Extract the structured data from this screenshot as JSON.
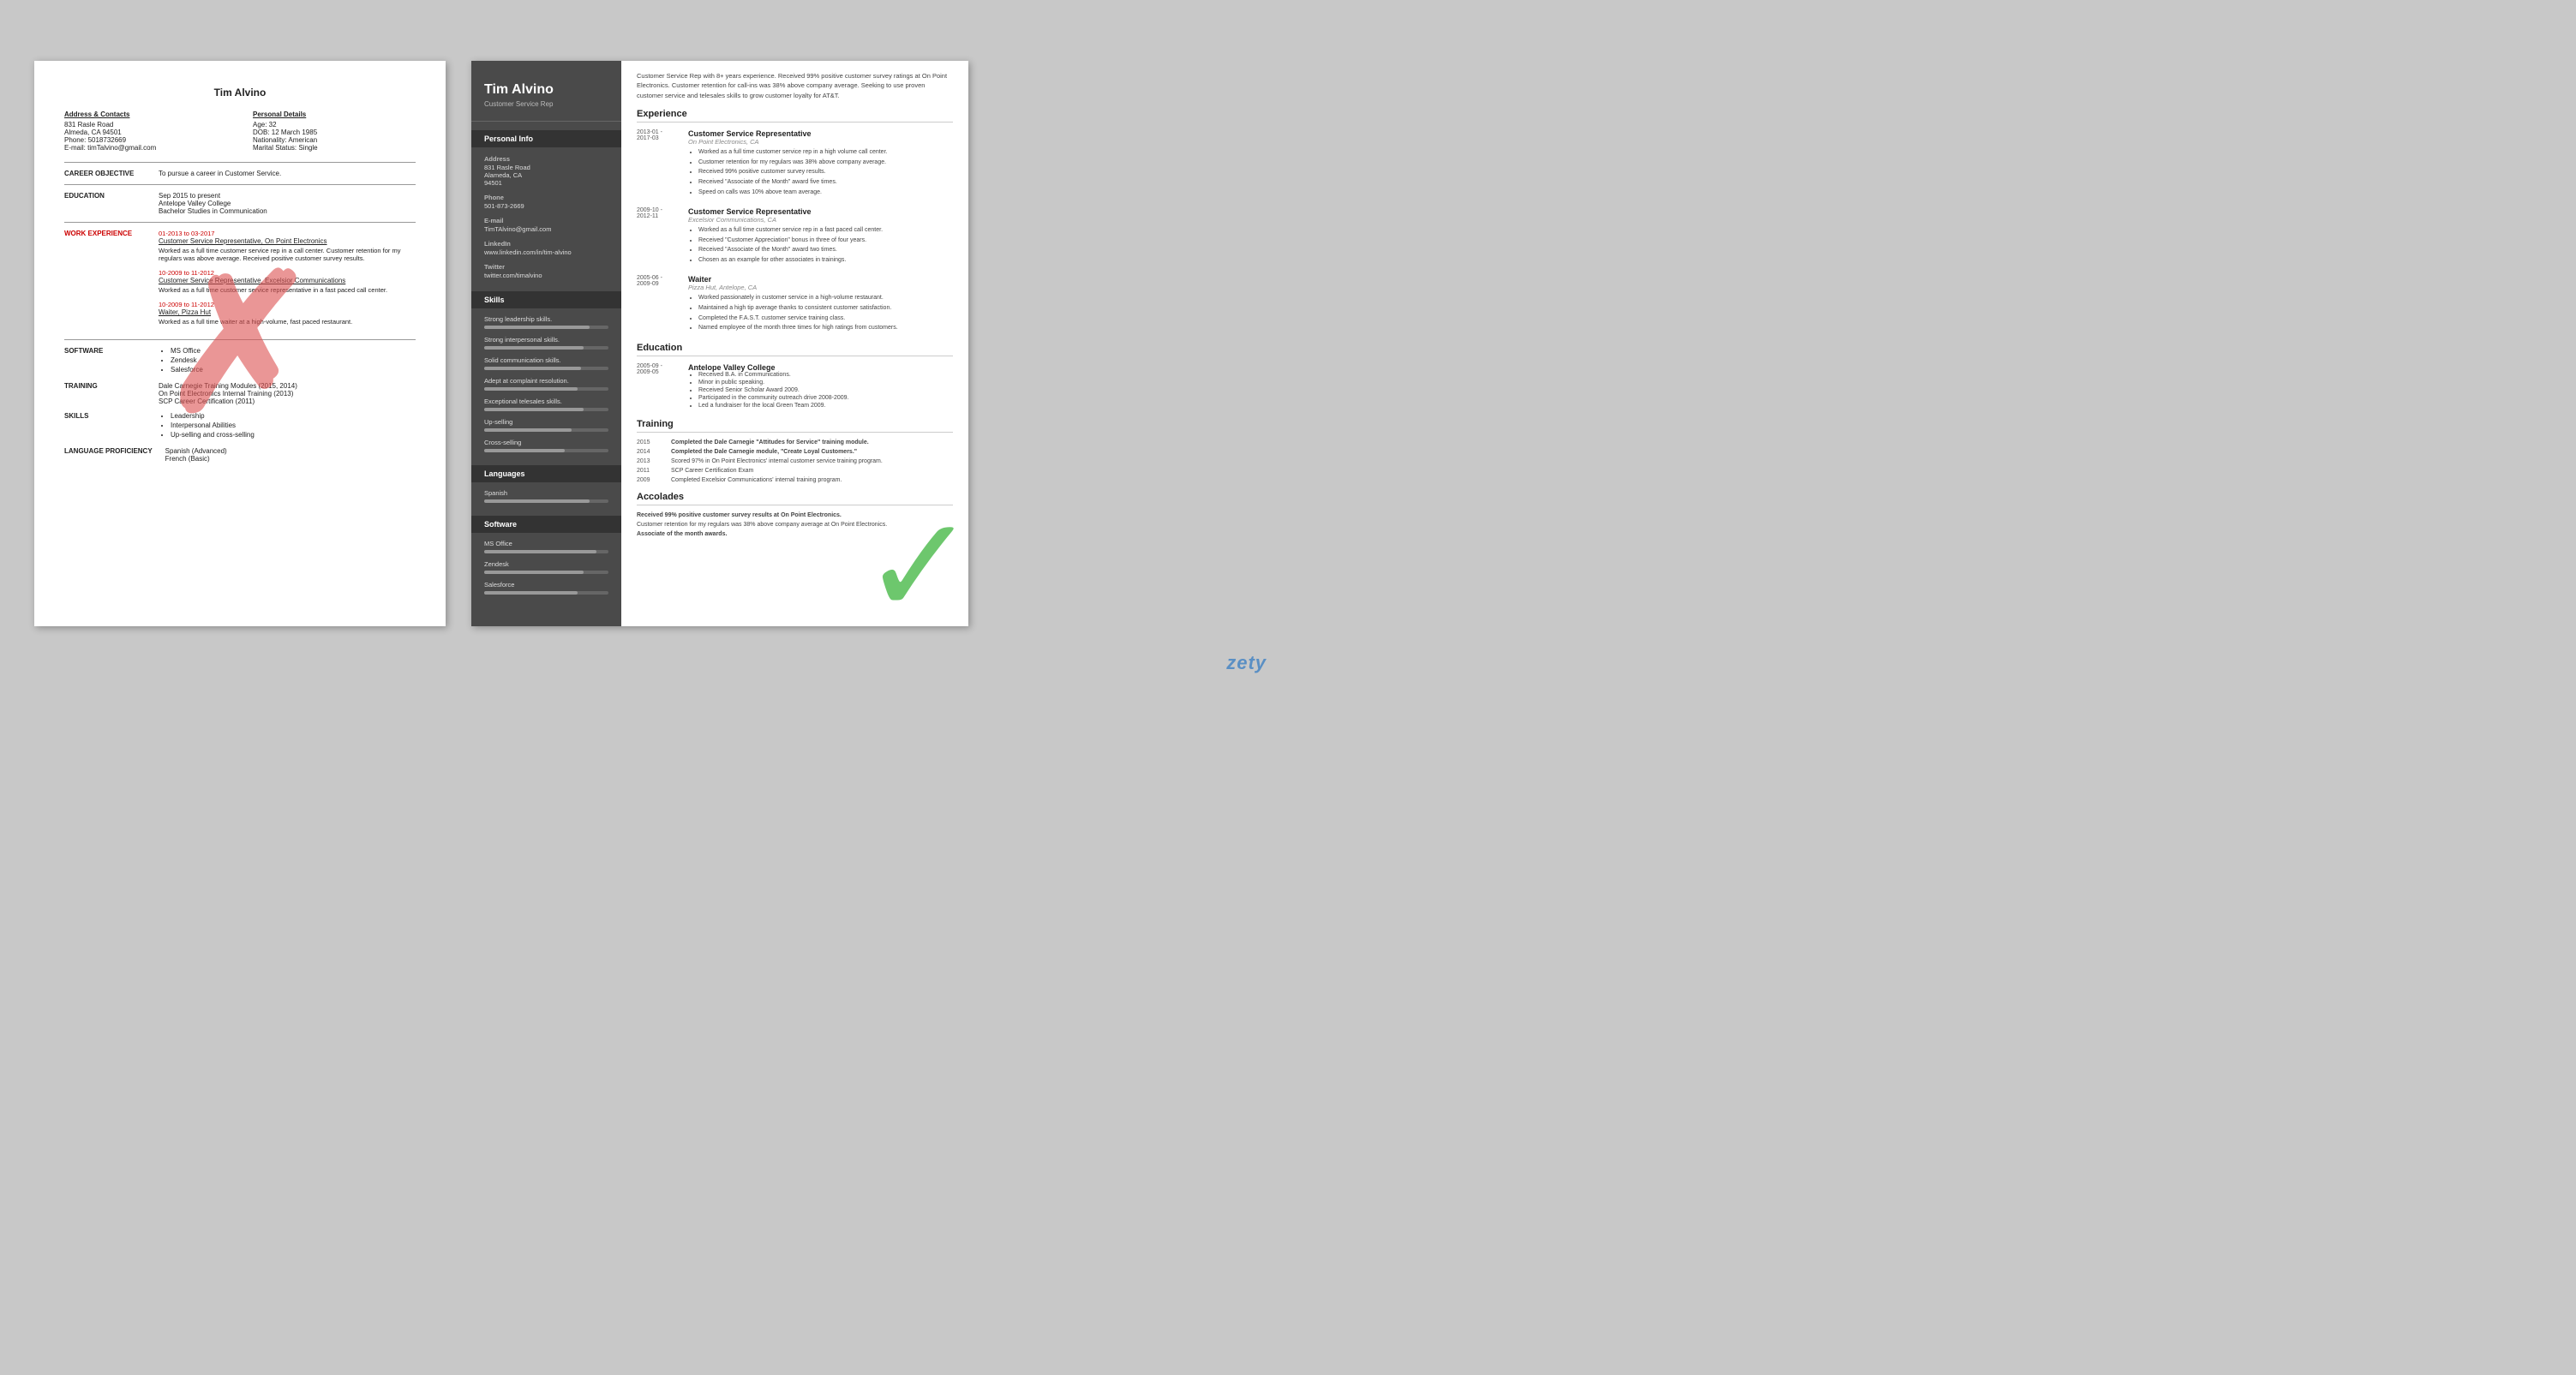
{
  "bad_resume": {
    "name": "Tim Alvino",
    "address_title": "Address & Contacts",
    "address_lines": [
      "831 Rasle Road",
      "Almeda, CA 94501",
      "Phone: 5018732669",
      "E-mail: timTalvino@gmail.com"
    ],
    "personal_title": "Personal Details",
    "personal_lines": [
      "Age:   32",
      "DOB:  12 March 1985",
      "Nationality: American",
      "Marital Status: Single"
    ],
    "career_objective_label": "CAREER OBJECTIVE",
    "career_objective": "To pursue a career in Customer Service.",
    "education_label": "EDUCATION",
    "education_period": "Sep 2015 to present",
    "education_school": "Antelope Valley College",
    "education_degree": "Bachelor Studies in Communication",
    "work_experience_label": "WORK EXPERIENCE",
    "work_entries": [
      {
        "date": "01-2013 to 03-2017",
        "title": "Customer Service Representative, On Point Electronics",
        "desc": "Worked as a full time customer service rep in a call center. Customer retention for my regulars was above average. Received positive customer survey results."
      },
      {
        "date": "10-2009 to 11-2012",
        "title": "Customer Service Representative, Excelsior Communications",
        "desc": "Worked as a full time customer service representative in a fast paced call center."
      },
      {
        "date": "10-2009 to 11-2012",
        "title": "Waiter, Pizza Hut",
        "desc": "Worked as a full time waiter at a high-volume, fast paced restaurant."
      }
    ],
    "software_label": "SOFTWARE",
    "software_items": [
      "MS Office",
      "Zendesk",
      "Salesforce"
    ],
    "training_label": "TRAINING",
    "training_items": [
      "Dale Carnegie Training Modules (2015, 2014)",
      "On Point Electronics Internal Training (2013)",
      "SCP Career Certification (2011)"
    ],
    "skills_label": "SKILLS",
    "skills_items": [
      "Leadership",
      "Interpersonal Abilities",
      "Up-selling and cross-selling"
    ],
    "language_label": "LANGUAGE PROFICIENCY",
    "language_items": [
      "Spanish (Advanced)",
      "French (Basic)"
    ]
  },
  "good_resume": {
    "name": "Tim Alvino",
    "title": "Customer Service Rep",
    "summary": "Customer Service Rep with 8+ years experience. Received 99% positive customer survey ratings at On Point Electronics. Customer retention for call-ins was 38% above company average. Seeking to use proven customer service and telesales skills to grow customer loyalty for AT&T.",
    "personal_info_header": "Personal Info",
    "address_label": "Address",
    "address_value": "831 Rasle Road\nAlameda, CA\n94501",
    "phone_label": "Phone",
    "phone_value": "501-873-2669",
    "email_label": "E-mail",
    "email_value": "TimTAlvino@gmail.com",
    "linkedin_label": "LinkedIn",
    "linkedin_value": "www.linkedin.com/in/tim-alvino",
    "twitter_label": "Twitter",
    "twitter_value": "twitter.com/timalvino",
    "skills_header": "Skills",
    "skills": [
      {
        "name": "Strong leadership skills.",
        "pct": 85
      },
      {
        "name": "Strong interpersonal skills.",
        "pct": 80
      },
      {
        "name": "Solid communication skills.",
        "pct": 78
      },
      {
        "name": "Adept at complaint resolution.",
        "pct": 75
      },
      {
        "name": "Exceptional telesales skills.",
        "pct": 80
      },
      {
        "name": "Up-selling",
        "pct": 70
      },
      {
        "name": "Cross-selling",
        "pct": 65
      }
    ],
    "languages_header": "Languages",
    "languages": [
      {
        "name": "Spanish",
        "pct": 85
      }
    ],
    "software_header": "Software",
    "software": [
      {
        "name": "MS Office",
        "pct": 90
      },
      {
        "name": "Zendesk",
        "pct": 80
      },
      {
        "name": "Salesforce",
        "pct": 75
      }
    ],
    "experience_header": "Experience",
    "experiences": [
      {
        "dates": "2013-01 -\n2017-03",
        "title": "Customer Service Representative",
        "company": "On Point Electronics, CA",
        "bullets": [
          "Worked as a full time customer service rep in a high volume call center.",
          "Customer retention for my regulars was 38% above company average.",
          "Received 99% positive customer survey results.",
          "Received \"Associate of the Month\" award five times.",
          "Speed on calls was 10% above team average."
        ]
      },
      {
        "dates": "2009-10 -\n2012-11",
        "title": "Customer Service Representative",
        "company": "Excelsior Communications, CA",
        "bullets": [
          "Worked as a full time customer service rep in a fast paced call center.",
          "Received \"Customer Appreciation\" bonus in three of four years.",
          "Received \"Associate of the Month\" award two times.",
          "Chosen as an example for other associates in trainings."
        ]
      },
      {
        "dates": "2005-06 -\n2009-09",
        "title": "Waiter",
        "company": "Pizza Hut, Antelope, CA",
        "bullets": [
          "Worked passionately in customer service in a high-volume restaurant.",
          "Maintained a high tip average thanks to consistent customer satisfaction.",
          "Completed the F.A.S.T. customer service training class.",
          "Named employee of the month three times for high ratings from customers."
        ]
      }
    ],
    "education_header": "Education",
    "educations": [
      {
        "dates": "2005-09 -\n2009-05",
        "school": "Antelope Valley College",
        "bullets": [
          "Received B.A. in Communications.",
          "Minor in public speaking.",
          "Received Senior Scholar Award 2009.",
          "Participated in the community outreach drive 2008-2009.",
          "Led a fundraiser for the local Green Team 2009."
        ]
      }
    ],
    "training_header": "Training",
    "training_entries": [
      {
        "year": "2015",
        "text": "Completed the Dale Carnegie \"Attitudes for Service\" training module."
      },
      {
        "year": "2014",
        "text": "Completed the Dale Carnegie module, \"Create Loyal Customers.\""
      },
      {
        "year": "2013",
        "text": "Scored 97% in On Point Electronics' internal customer service training program."
      },
      {
        "year": "2011",
        "text": "SCP Career Certification Exam"
      },
      {
        "year": "2009",
        "text": "Completed Excelsior Communications' internal training program."
      }
    ],
    "accolades_header": "Accolades",
    "accolades": [
      "Received 99% positive customer survey results at On Point Electronics.",
      "Customer retention for my regulars was 38% above company average at On Point Electronics.",
      "Associate of the month awards."
    ]
  },
  "watermark": "zety"
}
